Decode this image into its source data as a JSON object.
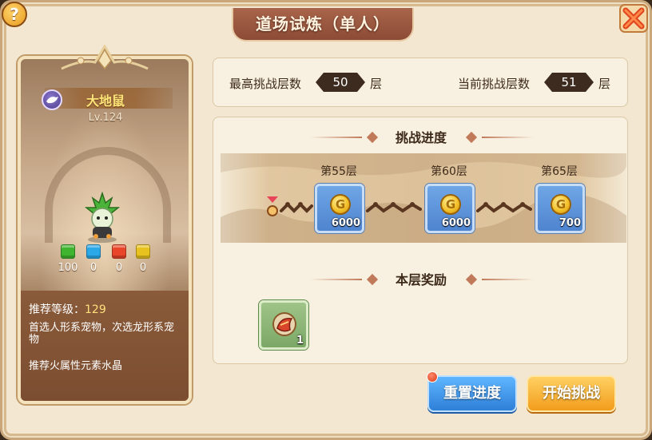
{
  "window": {
    "title": "道场试炼（单人）",
    "help_glyph": "?",
    "close_glyph": "✕"
  },
  "pet": {
    "name": "大地鼠",
    "level": "Lv.124",
    "gems": [
      {
        "color": "#3fb42e",
        "value": "100"
      },
      {
        "color": "#2aa8e8",
        "value": "0"
      },
      {
        "color": "#e8452a",
        "value": "0"
      },
      {
        "color": "#e8c21e",
        "value": "0"
      }
    ],
    "recommend_level_label": "推荐等级：",
    "recommend_level_value": "129",
    "recommend_pets": "首选人形系宠物，次选龙形系宠物",
    "recommend_crystal": "推荐火属性元素水晶"
  },
  "stats": {
    "highest_label": "最高挑战层数",
    "highest_value": "50",
    "highest_unit": "层",
    "current_label": "当前挑战层数",
    "current_value": "51",
    "current_unit": "层"
  },
  "progress": {
    "title": "挑战进度",
    "milestones": [
      {
        "floor": "第55层",
        "reward": "6000"
      },
      {
        "floor": "第60层",
        "reward": "6000"
      },
      {
        "floor": "第65层",
        "reward": "700"
      }
    ],
    "coin_glyph": "G"
  },
  "floor_reward": {
    "title": "本层奖励",
    "count": "1"
  },
  "buttons": {
    "reset": "重置进度",
    "start": "开始挑战"
  },
  "colors": {
    "accent_brown": "#8c4b36",
    "panel_bg": "#f8f0e0",
    "reset_button": "#2e7fd8",
    "start_button": "#f29d1c"
  }
}
